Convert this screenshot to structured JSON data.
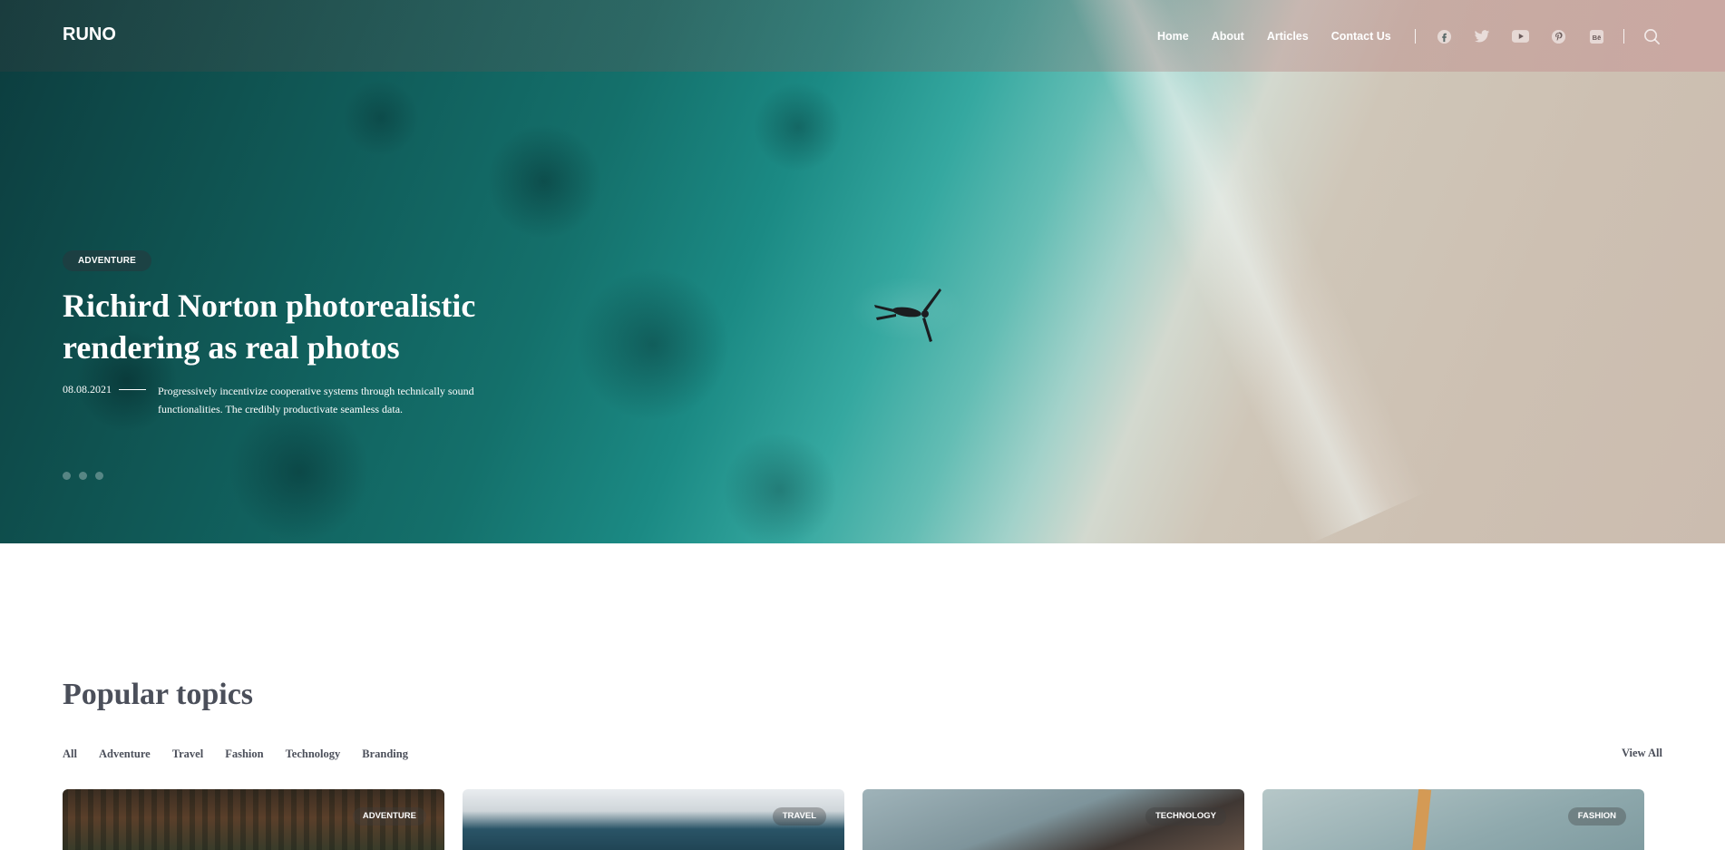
{
  "site": {
    "logo": "RUNO"
  },
  "nav": {
    "items": [
      {
        "label": "Home"
      },
      {
        "label": "About"
      },
      {
        "label": "Articles"
      },
      {
        "label": "Contact Us"
      }
    ],
    "social_icons": [
      "facebook-icon",
      "twitter-icon",
      "youtube-icon",
      "pinterest-icon",
      "behance-icon"
    ],
    "search_icon": "search-icon"
  },
  "hero": {
    "tag": "ADVENTURE",
    "title": "Richird Norton photorealistic rendering as real photos",
    "date": "08.08.2021",
    "description": "Progressively incentivize cooperative systems through technically sound functionalities. The credibly productivate seamless data.",
    "slide_count": 3,
    "active_slide": 1
  },
  "popular": {
    "title": "Popular topics",
    "filters": [
      "All",
      "Adventure",
      "Travel",
      "Fashion",
      "Technology",
      "Branding"
    ],
    "view_all": "View All",
    "cards": [
      {
        "tag": "ADVENTURE"
      },
      {
        "tag": "TRAVEL"
      },
      {
        "tag": "TECHNOLOGY"
      },
      {
        "tag": "FASHION"
      }
    ]
  },
  "colors": {
    "accent_text": "#4b4f5a",
    "hero_sea": "#1b8a84",
    "hero_sand": "#cdc0b2"
  }
}
